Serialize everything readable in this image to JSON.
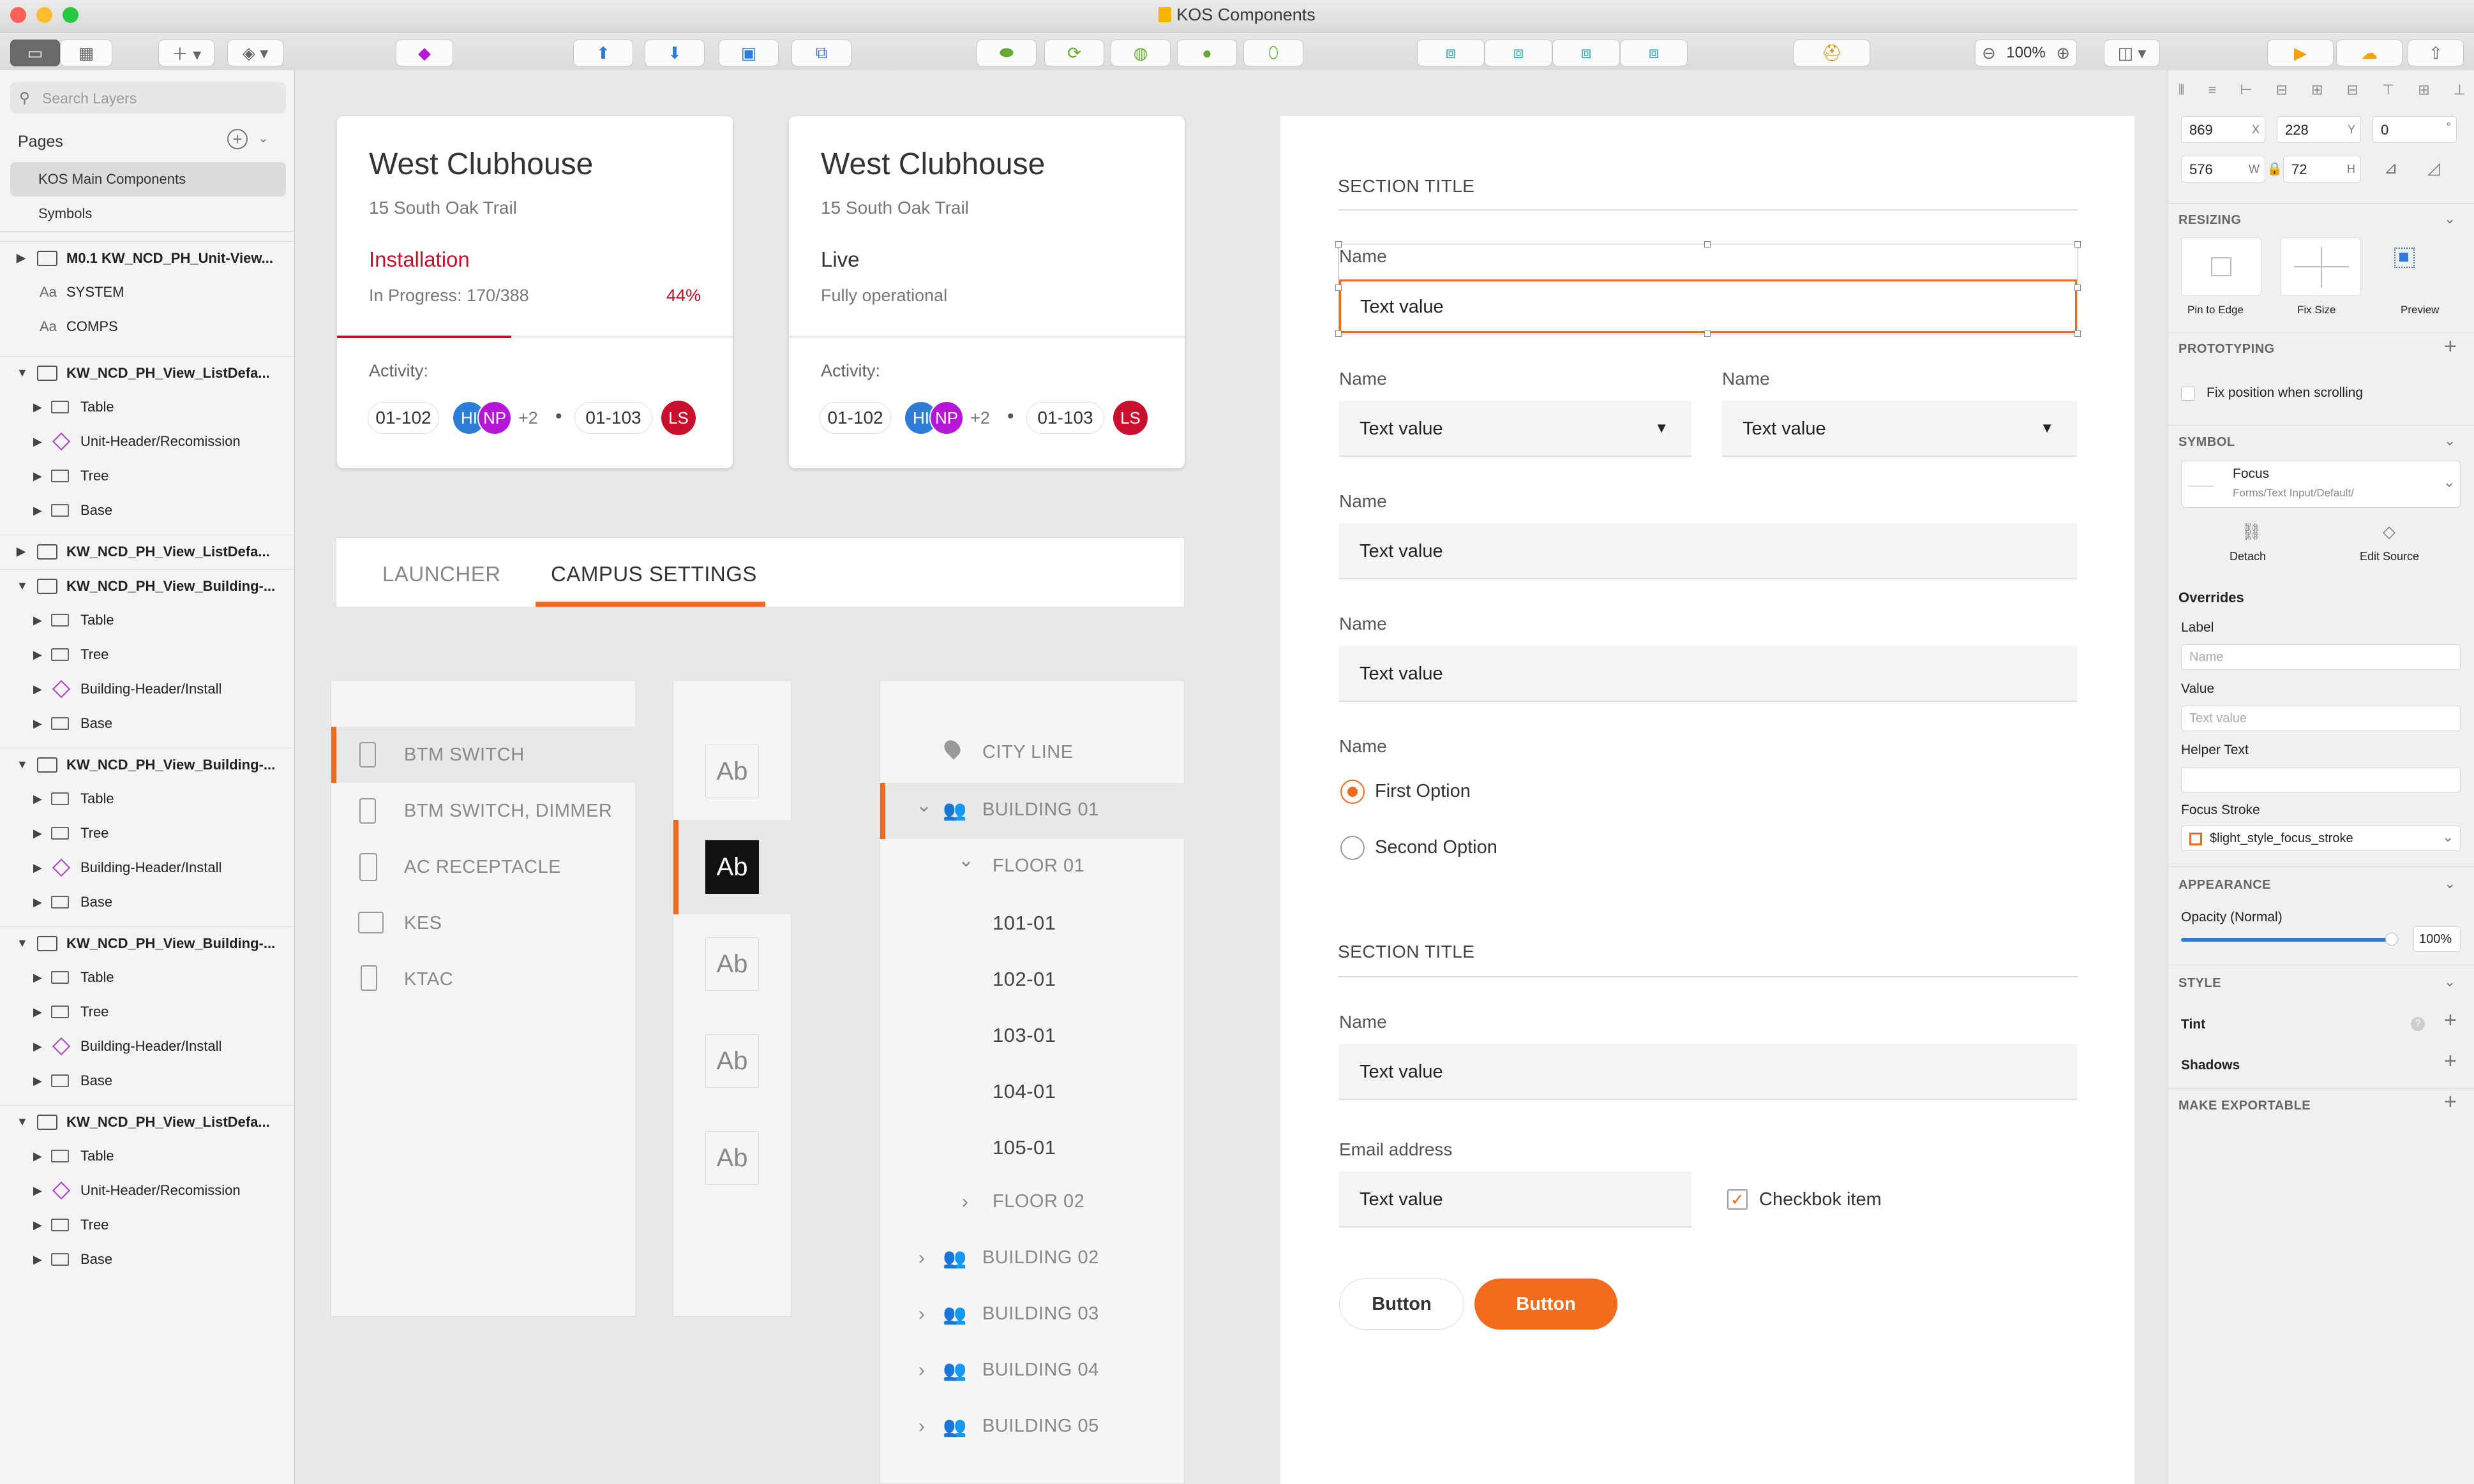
{
  "window": {
    "title": "KOS Components"
  },
  "toolbar": {
    "zoom": "100%"
  },
  "left_panel": {
    "search_placeholder": "Search Layers",
    "pages_label": "Pages",
    "pages": [
      "KOS Main Components",
      "Symbols"
    ],
    "layers": [
      {
        "label": "M0.1 KW_NCD_PH_Unit-View...",
        "type": "group",
        "open": false
      },
      {
        "label": "SYSTEM",
        "type": "text"
      },
      {
        "label": "COMPS",
        "type": "text"
      },
      {
        "label": "KW_NCD_PH_View_ListDefa...",
        "type": "group",
        "open": true
      },
      {
        "label": "Table",
        "type": "folder"
      },
      {
        "label": "Unit-Header/Recomission",
        "type": "symbol"
      },
      {
        "label": "Tree",
        "type": "folder"
      },
      {
        "label": "Base",
        "type": "folder"
      },
      {
        "label": "KW_NCD_PH_View_ListDefa...",
        "type": "group",
        "open": false
      },
      {
        "label": "KW_NCD_PH_View_Building-...",
        "type": "group",
        "open": true
      },
      {
        "label": "Table",
        "type": "folder"
      },
      {
        "label": "Tree",
        "type": "folder"
      },
      {
        "label": "Building-Header/Install",
        "type": "symbol"
      },
      {
        "label": "Base",
        "type": "folder"
      },
      {
        "label": "KW_NCD_PH_View_Building-...",
        "type": "group",
        "open": true
      },
      {
        "label": "Table",
        "type": "folder"
      },
      {
        "label": "Tree",
        "type": "folder"
      },
      {
        "label": "Building-Header/Install",
        "type": "symbol"
      },
      {
        "label": "Base",
        "type": "folder"
      },
      {
        "label": "KW_NCD_PH_View_Building-...",
        "type": "group",
        "open": true
      },
      {
        "label": "Table",
        "type": "folder"
      },
      {
        "label": "Tree",
        "type": "folder"
      },
      {
        "label": "Building-Header/Install",
        "type": "symbol"
      },
      {
        "label": "Base",
        "type": "folder"
      },
      {
        "label": "KW_NCD_PH_View_ListDefa...",
        "type": "group",
        "open": true
      },
      {
        "label": "Table",
        "type": "folder"
      },
      {
        "label": "Unit-Header/Recomission",
        "type": "symbol"
      },
      {
        "label": "Tree",
        "type": "folder"
      },
      {
        "label": "Base",
        "type": "folder"
      }
    ]
  },
  "cards": [
    {
      "title": "West Clubhouse",
      "address": "15 South Oak Trail",
      "status": "Installation",
      "status_color": "#c8102e",
      "detail": "In Progress:  170/388",
      "percent": "44%",
      "progress": 0.44,
      "activity": "Activity:",
      "unit1": "01-102",
      "unit2": "01-103",
      "extra": "+2",
      "avatars": [
        "HI",
        "NP",
        "LS"
      ]
    },
    {
      "title": "West Clubhouse",
      "address": "15 South Oak Trail",
      "status": "Live",
      "status_color": "#333333",
      "detail": "Fully operational",
      "percent": "",
      "activity": "Activity:",
      "unit1": "01-102",
      "unit2": "01-103",
      "extra": "+2",
      "avatars": [
        "HI",
        "NP",
        "LS"
      ]
    }
  ],
  "tabs": [
    "LAUNCHER",
    "CAMPUS SETTINGS"
  ],
  "device_menu": [
    "BTM SWITCH",
    "BTM SWITCH, DIMMER",
    "AC RECEPTACLE",
    "KES",
    "KTAC"
  ],
  "ab_tiles": [
    "Ab",
    "Ab",
    "Ab",
    "Ab",
    "Ab"
  ],
  "tree": {
    "city": "CITY LINE",
    "building01": "BUILDING 01",
    "floor01": "FLOOR 01",
    "rooms": [
      "101-01",
      "102-01",
      "103-01",
      "104-01",
      "105-01"
    ],
    "floor02": "FLOOR 02",
    "buildings": [
      "BUILDING 02",
      "BUILDING 03",
      "BUILDING 04",
      "BUILDING 05"
    ]
  },
  "form": {
    "section1": "SECTION TITLE",
    "name": "Name",
    "text_value": "Text value",
    "radio1": "First Option",
    "radio2": "Second Option",
    "section2": "SECTION TITLE",
    "email_label": "Email address",
    "checkbox": "Checkbok item",
    "button1": "Button",
    "button2": "Button"
  },
  "inspector": {
    "x": "869",
    "y": "228",
    "rot": "0",
    "w": "576",
    "h": "72",
    "x_l": "X",
    "y_l": "Y",
    "rot_l": "°",
    "w_l": "W",
    "h_l": "H",
    "resizing": "RESIZING",
    "pin": "Pin to Edge",
    "fix": "Fix Size",
    "preview": "Preview",
    "prototyping": "PROTOTYPING",
    "fixpos": "Fix position when scrolling",
    "symbol": "SYMBOL",
    "sym_name": "Focus",
    "sym_path": "Forms/Text Input/Default/",
    "detach": "Detach",
    "edit_source": "Edit Source",
    "overrides": "Overrides",
    "label": "Label",
    "label_ph": "Name",
    "value": "Value",
    "value_ph": "Text value",
    "helper": "Helper Text",
    "focus_stroke": "Focus Stroke",
    "stroke_val": "$light_style_focus_stroke",
    "appearance": "APPEARANCE",
    "opacity": "Opacity (Normal)",
    "opacity_val": "100%",
    "opacity_level": 1.0,
    "style": "STYLE",
    "tint": "Tint",
    "shadows": "Shadows",
    "exportable": "MAKE EXPORTABLE"
  },
  "colors": {
    "accent": "#f26a1b",
    "danger": "#c8102e",
    "blue": "#2d7dd8",
    "purple": "#b517d6"
  }
}
